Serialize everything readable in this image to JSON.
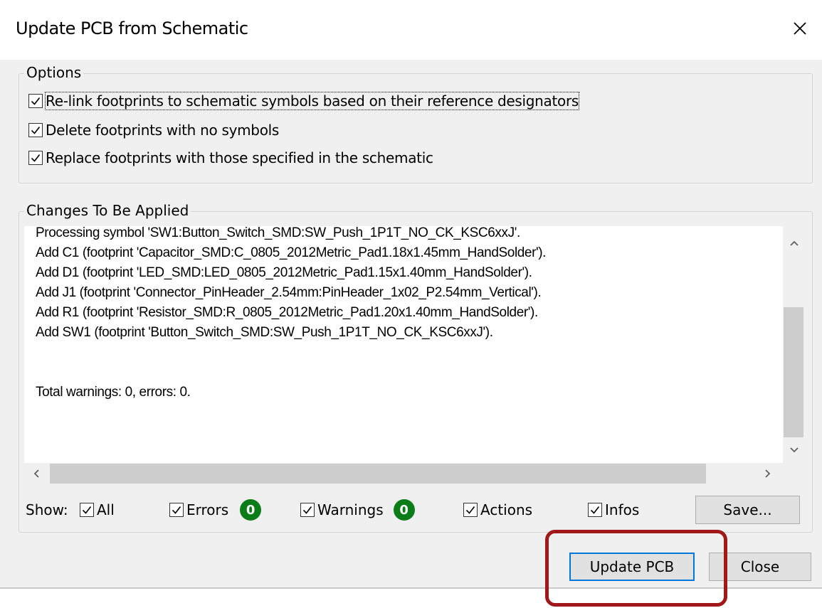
{
  "window": {
    "title": "Update PCB from Schematic"
  },
  "options": {
    "label": "Options",
    "items": [
      {
        "label": "Re-link footprints to schematic symbols based on their reference designators",
        "checked": true
      },
      {
        "label": "Delete footprints with no symbols",
        "checked": true
      },
      {
        "label": "Replace footprints with those specified in the schematic",
        "checked": true
      }
    ]
  },
  "changes": {
    "label": "Changes To Be Applied",
    "lines": [
      "Processing symbol 'SW1:Button_Switch_SMD:SW_Push_1P1T_NO_CK_KSC6xxJ'.",
      "Add C1 (footprint 'Capacitor_SMD:C_0805_2012Metric_Pad1.18x1.45mm_HandSolder').",
      "Add D1 (footprint 'LED_SMD:LED_0805_2012Metric_Pad1.15x1.40mm_HandSolder').",
      "Add J1 (footprint 'Connector_PinHeader_2.54mm:PinHeader_1x02_P2.54mm_Vertical').",
      "Add R1 (footprint 'Resistor_SMD:R_0805_2012Metric_Pad1.20x1.40mm_HandSolder').",
      "Add SW1 (footprint 'Button_Switch_SMD:SW_Push_1P1T_NO_CK_KSC6xxJ').",
      "Total warnings: 0, errors: 0."
    ]
  },
  "filters": {
    "show_label": "Show:",
    "all": "All",
    "errors": "Errors",
    "errors_count": "0",
    "warnings": "Warnings",
    "warnings_count": "0",
    "actions": "Actions",
    "infos": "Infos"
  },
  "buttons": {
    "save": "Save...",
    "update": "Update PCB",
    "close": "Close"
  },
  "colors": {
    "badge": "#0a7d19",
    "highlight": "#a01818",
    "default_button_border": "#0078d7"
  },
  "icons": [
    "close-icon",
    "checkmark-icon",
    "scroll-up-icon",
    "scroll-down-icon",
    "scroll-left-icon",
    "scroll-right-icon"
  ]
}
